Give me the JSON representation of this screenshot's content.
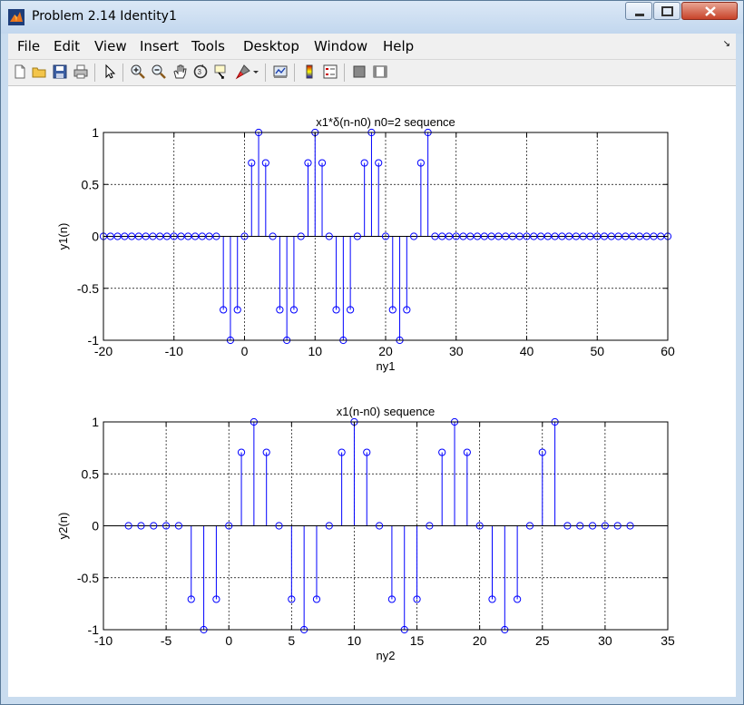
{
  "window": {
    "title": "Problem 2.14 Identity1"
  },
  "menu": [
    "File",
    "Edit",
    "View",
    "Insert",
    "Tools",
    "Desktop",
    "Window",
    "Help"
  ],
  "toolbar_icons": [
    "new-figure-icon",
    "open-file-icon",
    "save-icon",
    "print-icon",
    "select-arrow-icon",
    "zoom-in-icon",
    "zoom-out-icon",
    "pan-hand-icon",
    "rotate-3d-icon",
    "data-cursor-icon",
    "brush-icon",
    "brush-dropdown-icon",
    "link-plot-icon",
    "insert-colorbar-icon",
    "insert-legend-icon",
    "hide-plot-tools-icon",
    "show-plot-tools-icon"
  ],
  "colors": {
    "stem": "#0000ff",
    "axis": "#000000",
    "grid": "#000000",
    "background": "#ffffff"
  },
  "chart_data": [
    {
      "type": "stem",
      "title": "x1*δ(n-n0) n0=2 sequence",
      "xlabel": "ny1",
      "ylabel": "y1(n)",
      "xlim": [
        -20,
        60
      ],
      "ylim": [
        -1,
        1
      ],
      "xticks": [
        -20,
        -10,
        0,
        10,
        20,
        30,
        40,
        50,
        60
      ],
      "yticks": [
        -1,
        -0.5,
        0,
        0.5,
        1
      ],
      "grid": true,
      "x": [
        -20,
        -19,
        -18,
        -17,
        -16,
        -15,
        -14,
        -13,
        -12,
        -11,
        -10,
        -9,
        -8,
        -7,
        -6,
        -5,
        -4,
        -3,
        -2,
        -1,
        0,
        1,
        2,
        3,
        4,
        5,
        6,
        7,
        8,
        9,
        10,
        11,
        12,
        13,
        14,
        15,
        16,
        17,
        18,
        19,
        20,
        21,
        22,
        23,
        24,
        25,
        26,
        27,
        28,
        29,
        30,
        31,
        32,
        33,
        34,
        35,
        36,
        37,
        38,
        39,
        40,
        41,
        42,
        43,
        44,
        45,
        46,
        47,
        48,
        49,
        50,
        51,
        52,
        53,
        54,
        55,
        56,
        57,
        58,
        59,
        60
      ],
      "y": [
        0,
        0,
        0,
        0,
        0,
        0,
        0,
        0,
        0,
        0,
        0,
        0,
        0,
        0,
        0,
        0,
        0,
        -0.707,
        -1,
        -0.707,
        0,
        0.707,
        1,
        0.707,
        0,
        -0.707,
        -1,
        -0.707,
        0,
        0.707,
        1,
        0.707,
        0,
        -0.707,
        -1,
        -0.707,
        0,
        0.707,
        1,
        0.707,
        0,
        -0.707,
        -1,
        -0.707,
        0,
        0.707,
        1,
        0,
        0,
        0,
        0,
        0,
        0,
        0,
        0,
        0,
        0,
        0,
        0,
        0,
        0,
        0,
        0,
        0,
        0,
        0,
        0,
        0,
        0,
        0,
        0,
        0,
        0,
        0,
        0,
        0,
        0,
        0,
        0,
        0,
        0
      ]
    },
    {
      "type": "stem",
      "title": "x1(n-n0) sequence",
      "xlabel": "ny2",
      "ylabel": "y2(n)",
      "xlim": [
        -10,
        35
      ],
      "ylim": [
        -1,
        1
      ],
      "xticks": [
        -10,
        -5,
        0,
        5,
        10,
        15,
        20,
        25,
        30,
        35
      ],
      "yticks": [
        -1,
        -0.5,
        0,
        0.5,
        1
      ],
      "grid": true,
      "x": [
        -8,
        -7,
        -6,
        -5,
        -4,
        -3,
        -2,
        -1,
        0,
        1,
        2,
        3,
        4,
        5,
        6,
        7,
        8,
        9,
        10,
        11,
        12,
        13,
        14,
        15,
        16,
        17,
        18,
        19,
        20,
        21,
        22,
        23,
        24,
        25,
        26,
        27,
        28,
        29,
        30,
        31,
        32
      ],
      "y": [
        0,
        0,
        0,
        0,
        0,
        -0.707,
        -1,
        -0.707,
        0,
        0.707,
        1,
        0.707,
        0,
        -0.707,
        -1,
        -0.707,
        0,
        0.707,
        1,
        0.707,
        0,
        -0.707,
        -1,
        -0.707,
        0,
        0.707,
        1,
        0.707,
        0,
        -0.707,
        -1,
        -0.707,
        0,
        0.707,
        1,
        0,
        0,
        0,
        0,
        0,
        0
      ]
    }
  ]
}
